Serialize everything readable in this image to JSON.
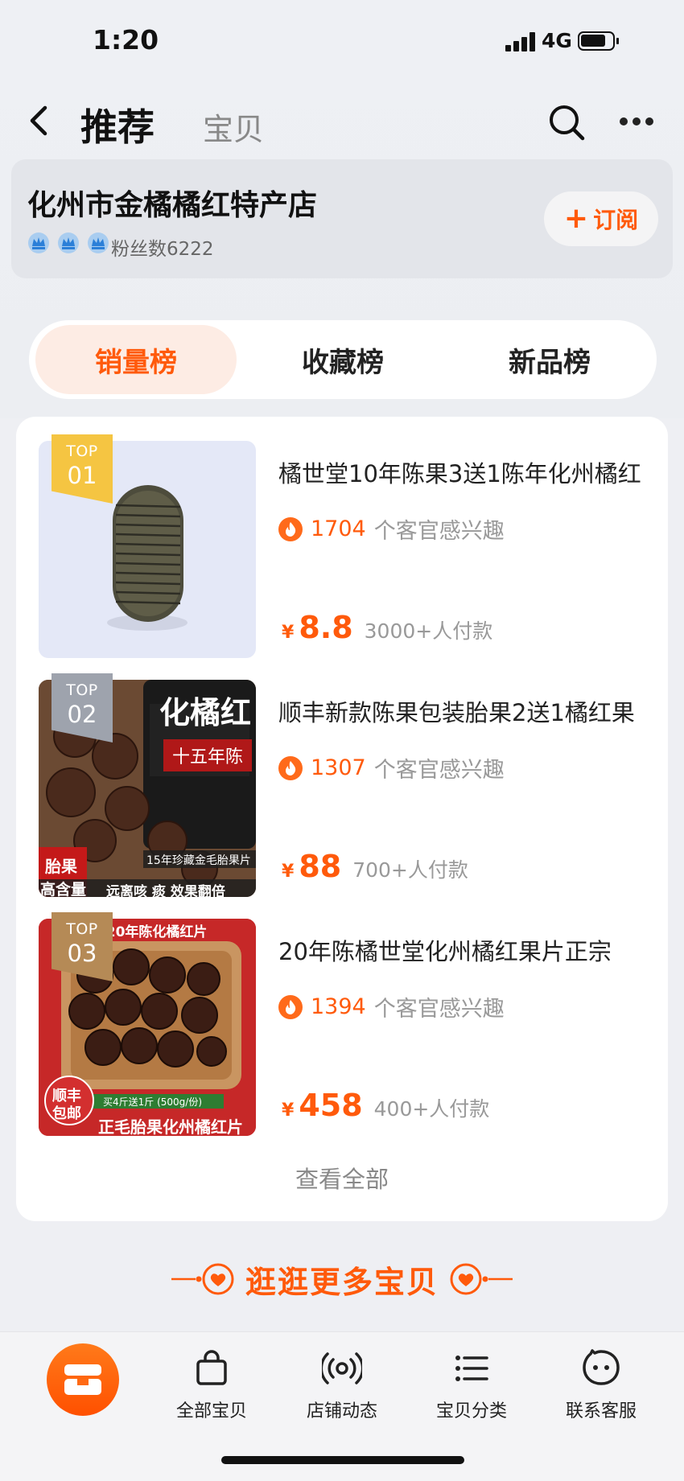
{
  "status_bar": {
    "time": "1:20",
    "network": "4G"
  },
  "nav": {
    "active_tab": "推荐",
    "tab2": "宝贝"
  },
  "shop": {
    "name": "化州市金橘橘红特产店",
    "fans": "粉丝数6222",
    "subscribe_label": "订阅"
  },
  "rank_tabs": [
    {
      "label": "销量榜",
      "active": true
    },
    {
      "label": "收藏榜",
      "active": false
    },
    {
      "label": "新品榜",
      "active": false
    }
  ],
  "items": [
    {
      "badge_top": "TOP",
      "badge_num": "01",
      "title": "橘世堂10年陈果3送1陈年化州橘红",
      "interest_count": "1704",
      "interest_text": "个客官感兴趣",
      "currency": "¥",
      "price": "8.8",
      "paid": "3000+人付款",
      "badge_color": "#f5c542"
    },
    {
      "badge_top": "TOP",
      "badge_num": "02",
      "title": "顺丰新款陈果包装胎果2送1橘红果",
      "interest_count": "1307",
      "interest_text": "个客官感兴趣",
      "currency": "¥",
      "price": "88",
      "paid": "700+人付款",
      "badge_color": "#9ea3ad",
      "img_text": {
        "product": "化橘红",
        "sub": "十五年陈",
        "strip": "15年珍藏金毛胎果片",
        "corner1": "胎果",
        "corner2": "高含量",
        "slogan": "远离咳 痰  效果翻倍"
      }
    },
    {
      "badge_top": "TOP",
      "badge_num": "03",
      "title": "20年陈橘世堂化州橘红果片正宗",
      "interest_count": "1394",
      "interest_text": "个客官感兴趣",
      "currency": "¥",
      "price": "458",
      "paid": "400+人付款",
      "badge_color": "#b58a56",
      "img_text": {
        "top": "[20年陈化橘红片",
        "ribbon": "买4斤送1斤 (500g/份)",
        "bottom": "正毛胎果化州橘红片",
        "stamp1": "顺丰",
        "stamp2": "包邮"
      }
    }
  ],
  "view_all": "查看全部",
  "more_banner": "逛逛更多宝贝",
  "tabbar": [
    {
      "label": "全部宝贝",
      "icon": "bag-icon"
    },
    {
      "label": "店铺动态",
      "icon": "broadcast-icon"
    },
    {
      "label": "宝贝分类",
      "icon": "list-icon"
    },
    {
      "label": "联系客服",
      "icon": "chat-face-icon"
    }
  ],
  "colors": {
    "accent": "#ff5a0b",
    "tab_active_bg": "#fdece4"
  }
}
